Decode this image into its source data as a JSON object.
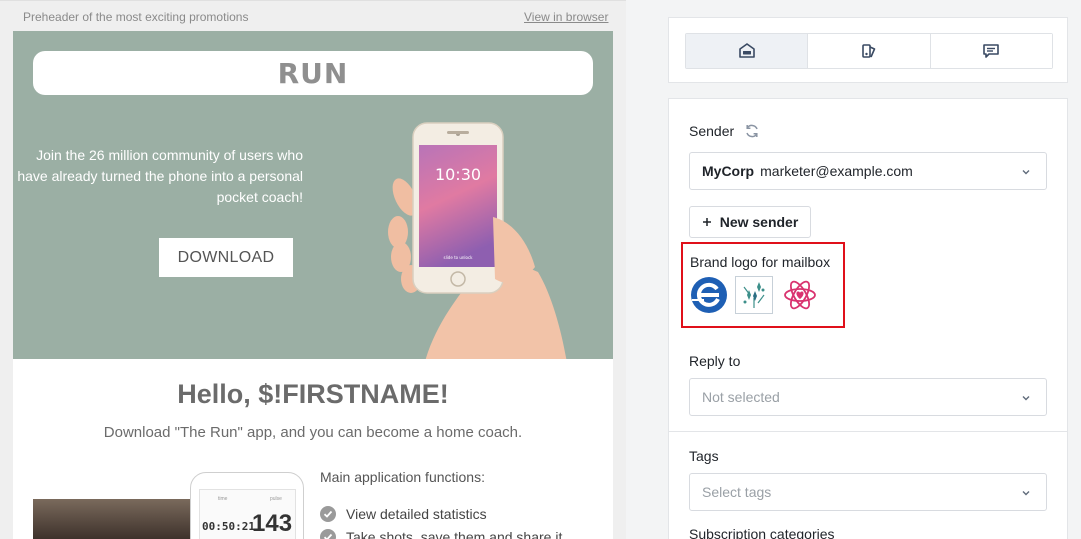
{
  "preview": {
    "preheader": "Preheader of the most exciting promotions",
    "view_in_browser": "View in browser",
    "logo_text": "RUN",
    "hero_text": "Join the 26 million community of users who have already turned the phone into a personal pocket coach!",
    "download_label": "DOWNLOAD",
    "phone_time": "10:30",
    "phone_unlock": "slide to unlock",
    "greeting": "Hello, $!FIRSTNAME!",
    "subline": "Download \"The Run\" app, and you can become a home coach.",
    "small_phone": {
      "time": "00:50:21",
      "number": "143",
      "label_left": "time",
      "label_right": "pulse"
    },
    "features_title": "Main application functions:",
    "features": [
      "View detailed statistics",
      "Take shots, save them and share it"
    ]
  },
  "panel": {
    "tabs": [
      {
        "icon": "sender-card-icon",
        "active": true
      },
      {
        "icon": "palette-icon",
        "active": false
      },
      {
        "icon": "comment-icon",
        "active": false
      }
    ],
    "sender": {
      "label": "Sender",
      "name": "MyCorp",
      "email": "marketer@example.com",
      "new_sender_label": "New sender"
    },
    "brand_logo": {
      "label": "Brand logo for mailbox",
      "logos": [
        "e-logo",
        "sparkle-logo",
        "atom-heart-logo"
      ]
    },
    "reply_to": {
      "label": "Reply to",
      "placeholder": "Not selected"
    },
    "tags": {
      "label": "Tags",
      "placeholder": "Select tags"
    },
    "subscription": {
      "label": "Subscription categories"
    }
  },
  "colors": {
    "hero_bg": "#9bafa4",
    "highlight": "#e0101a",
    "brand_blue": "#1e5fb4",
    "brand_pink": "#d9336f"
  }
}
